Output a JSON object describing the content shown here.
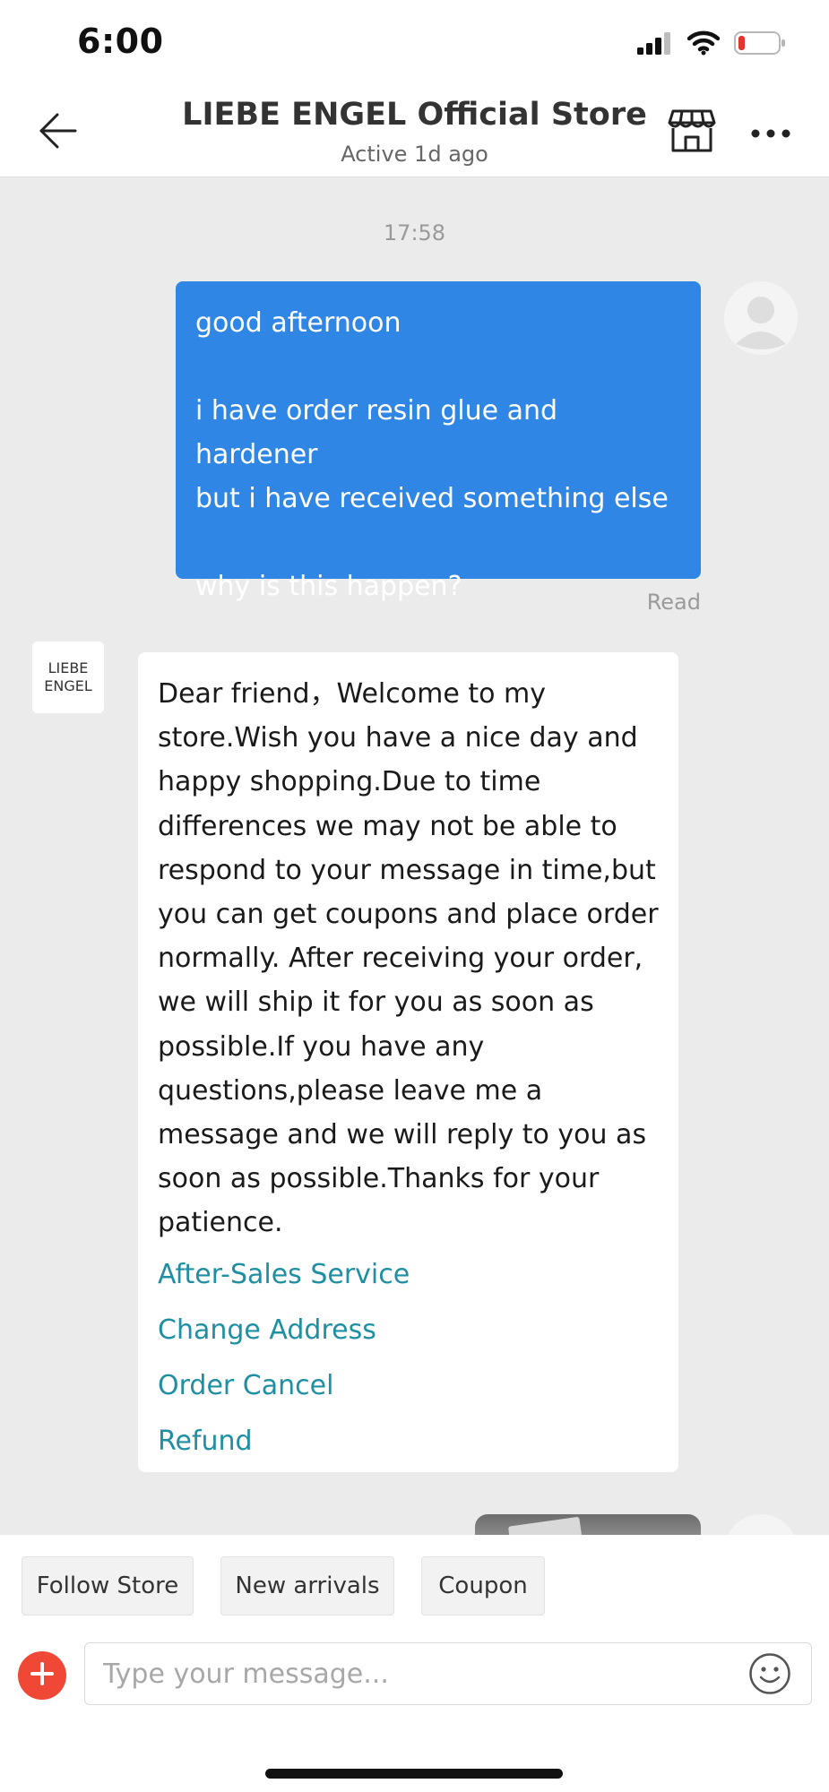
{
  "status_bar": {
    "time": "6:00",
    "icons": [
      "signal-icon",
      "wifi-icon",
      "battery-icon"
    ],
    "battery_color": "#e0342e"
  },
  "header": {
    "title": "LIEBE ENGEL Official Store",
    "subtitle": "Active 1d ago",
    "icons": [
      "back-arrow-icon",
      "store-icon",
      "more-icon"
    ]
  },
  "chat": {
    "timestamp": "17:58",
    "outgoing": {
      "lines": [
        "good afternoon",
        "",
        "i have order resin glue and hardener",
        "but i have received something else",
        "",
        "why is this happen?"
      ],
      "status": "Read",
      "bubble_color": "#2f86e4"
    },
    "store_avatar": {
      "line1": "LIEBE",
      "line2": "ENGEL"
    },
    "incoming": {
      "text": "Dear friend，Welcome to my store.Wish you have a nice day and happy shopping.Due to time differences we may not be able to respond to your message in time,but you can get coupons and place order normally. After receiving your order, we will ship it for you as soon as possible.If you have any questions,please leave me a message and we will reply to you as soon as possible.Thanks for your patience.",
      "links": [
        "After-Sales Service",
        "Change Address",
        "Order Cancel",
        "Refund"
      ],
      "link_color": "#1f8fa3"
    }
  },
  "chips": [
    "Follow Store",
    "New arrivals",
    "Coupon"
  ],
  "composer": {
    "placeholder": "Type your message...",
    "add_button_color": "#ef4836",
    "icons": [
      "plus-icon",
      "emoji-icon"
    ]
  }
}
